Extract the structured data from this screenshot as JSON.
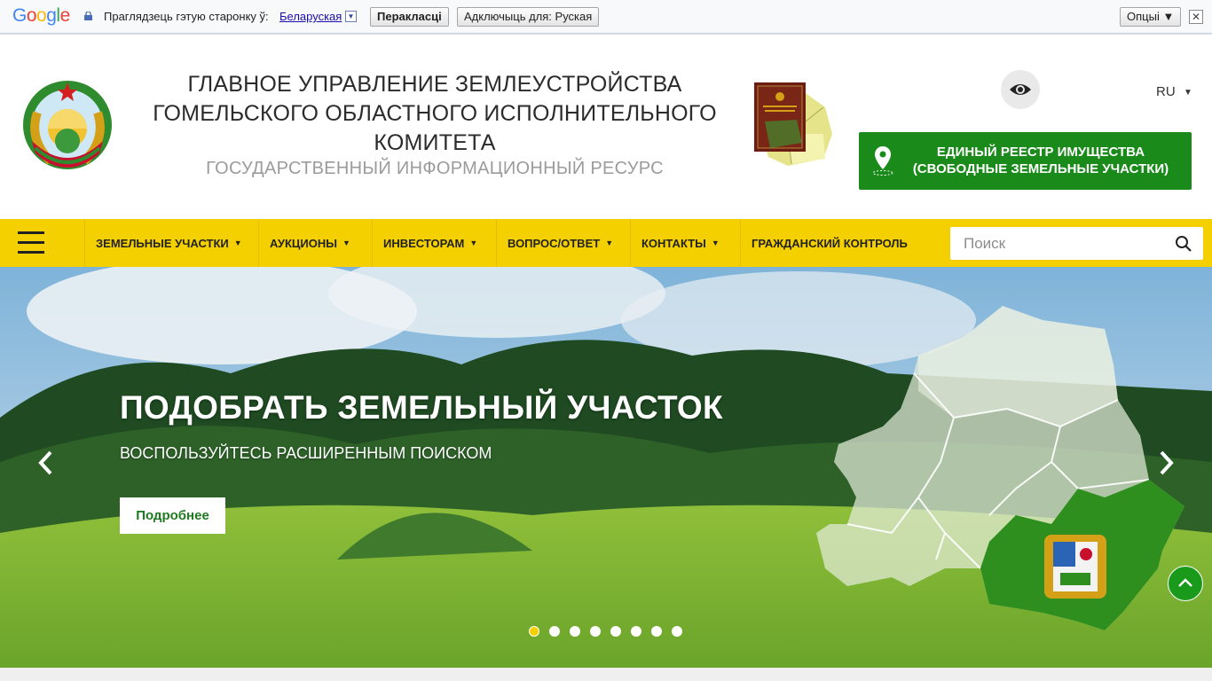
{
  "translate_bar": {
    "logo": "Google",
    "prompt": "Праглядзець гэтую старонку ў:",
    "language": "Беларуская",
    "translate_button": "Перакласці",
    "disable_button": "Адключыць для: Руская",
    "options_button": "Опцыі ▼",
    "close_symbol": "✕"
  },
  "header": {
    "title_line1": "ГЛАВНОЕ УПРАВЛЕНИЕ ЗЕМЛЕУСТРОЙСТВА",
    "title_line2": "ГОМЕЛЬСКОГО ОБЛАСТНОГО ИСПОЛНИТЕЛЬНОГО",
    "title_line3": "КОМИТЕТА",
    "subtitle": "ГОСУДАРСТВЕННЫЙ ИНФОРМАЦИОННЫЙ РЕСУРС",
    "emblem_icon": "state-emblem-icon",
    "book_icon": "land-fund-book-icon",
    "accessibility_icon": "eye-icon",
    "language": "RU",
    "language_caret": "▼",
    "registry_line1": "ЕДИНЫЙ РЕЕСТР ИМУЩЕСТВА",
    "registry_line2": "(СВОБОДНЫЕ ЗЕМЕЛЬНЫЕ УЧАСТКИ)"
  },
  "nav": {
    "items": [
      {
        "label": "ЗЕМЕЛЬНЫЕ УЧАСТКИ",
        "caret": "▼"
      },
      {
        "label": "АУКЦИОНЫ",
        "caret": "▼"
      },
      {
        "label": "ИНВЕСТОРАМ",
        "caret": "▼"
      },
      {
        "label": "ВОПРОС/ОТВЕТ",
        "caret": "▼"
      },
      {
        "label": "КОНТАКТЫ",
        "caret": "▼"
      },
      {
        "label": "ГРАЖДАНСКИЙ КОНТРОЛЬ",
        "caret": ""
      }
    ],
    "search_placeholder": "Поиск"
  },
  "hero": {
    "title": "ПОДОБРАТЬ ЗЕМЕЛЬНЫЙ УЧАСТОК",
    "subtitle": "ВОСПОЛЬЗУЙТЕСЬ РАСШИРЕННЫМ ПОИСКОМ",
    "button": "Подробнее",
    "slide_count": 8,
    "active_slide": 1
  },
  "colors": {
    "nav_yellow": "#f5d000",
    "brand_green": "#1a8a1a"
  }
}
